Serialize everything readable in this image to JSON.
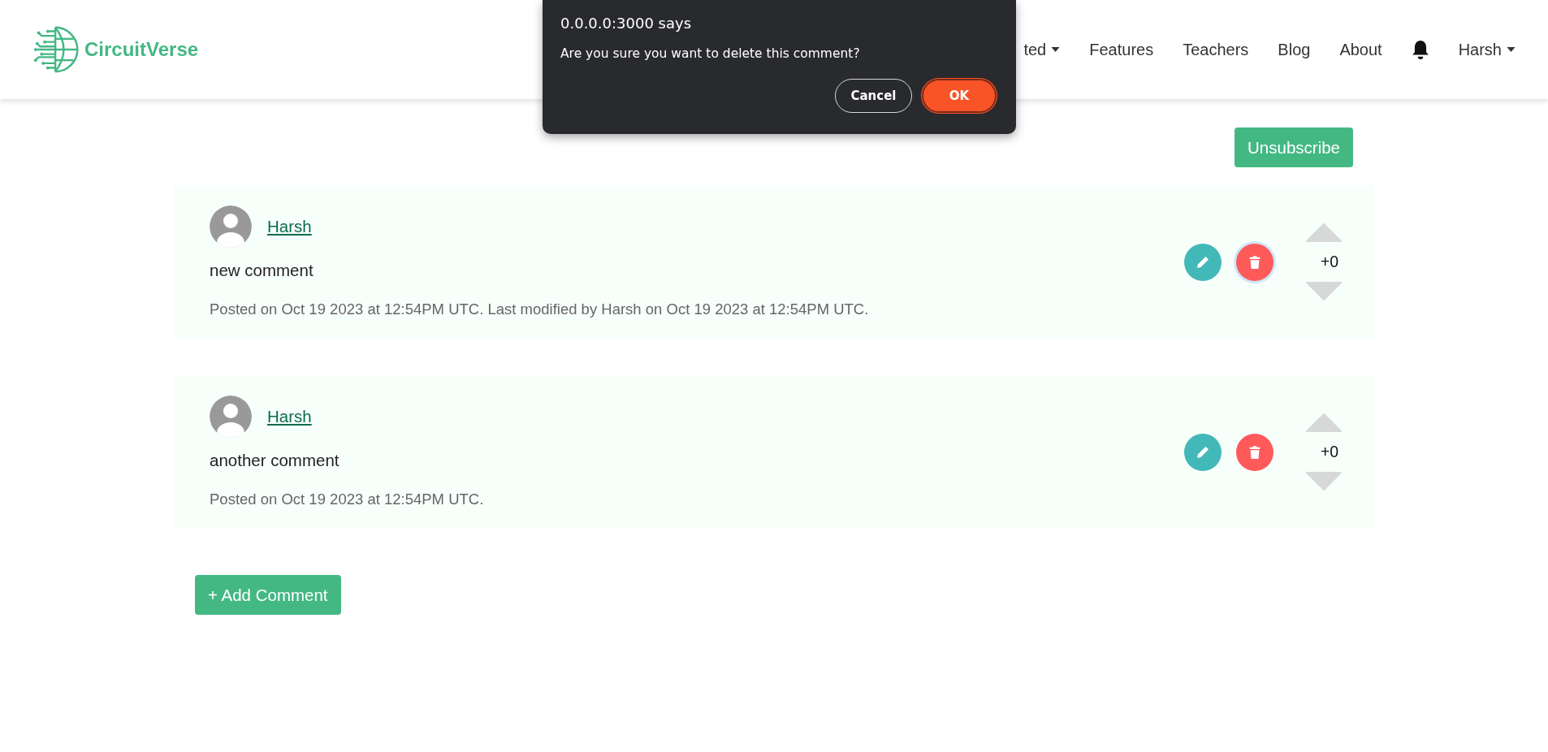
{
  "header": {
    "logo": "CircuitVerse",
    "nav": [
      {
        "kind": "link",
        "label": "ted",
        "dropdown": true
      },
      {
        "kind": "link",
        "label": "Features",
        "dropdown": false
      },
      {
        "kind": "link",
        "label": "Teachers",
        "dropdown": false
      },
      {
        "kind": "link",
        "label": "Blog",
        "dropdown": false
      },
      {
        "kind": "link",
        "label": "About",
        "dropdown": false
      },
      {
        "kind": "bell"
      },
      {
        "kind": "link",
        "label": "Harsh",
        "dropdown": true
      }
    ]
  },
  "dialog": {
    "title": "0.0.0.0:3000 says",
    "message": "Are you sure you want to delete this comment?",
    "buttons": [
      {
        "label": "Cancel",
        "kind": "secondary"
      },
      {
        "label": "OK",
        "kind": "primary"
      }
    ]
  },
  "unsubscribe": "Unsubscribe",
  "comments": [
    {
      "author": "Harsh",
      "body": "new comment",
      "meta": "Posted on Oct 19 2023 at 12:54PM UTC. Last modified by Harsh on Oct 19 2023 at 12:54PM UTC.",
      "votes": "+0",
      "delete_focused": true
    },
    {
      "author": "Harsh",
      "body": "another comment",
      "meta": "Posted on Oct 19 2023 at 12:54PM UTC.",
      "votes": "+0",
      "delete_focused": false
    }
  ],
  "add_comment": "+ Add Comment"
}
